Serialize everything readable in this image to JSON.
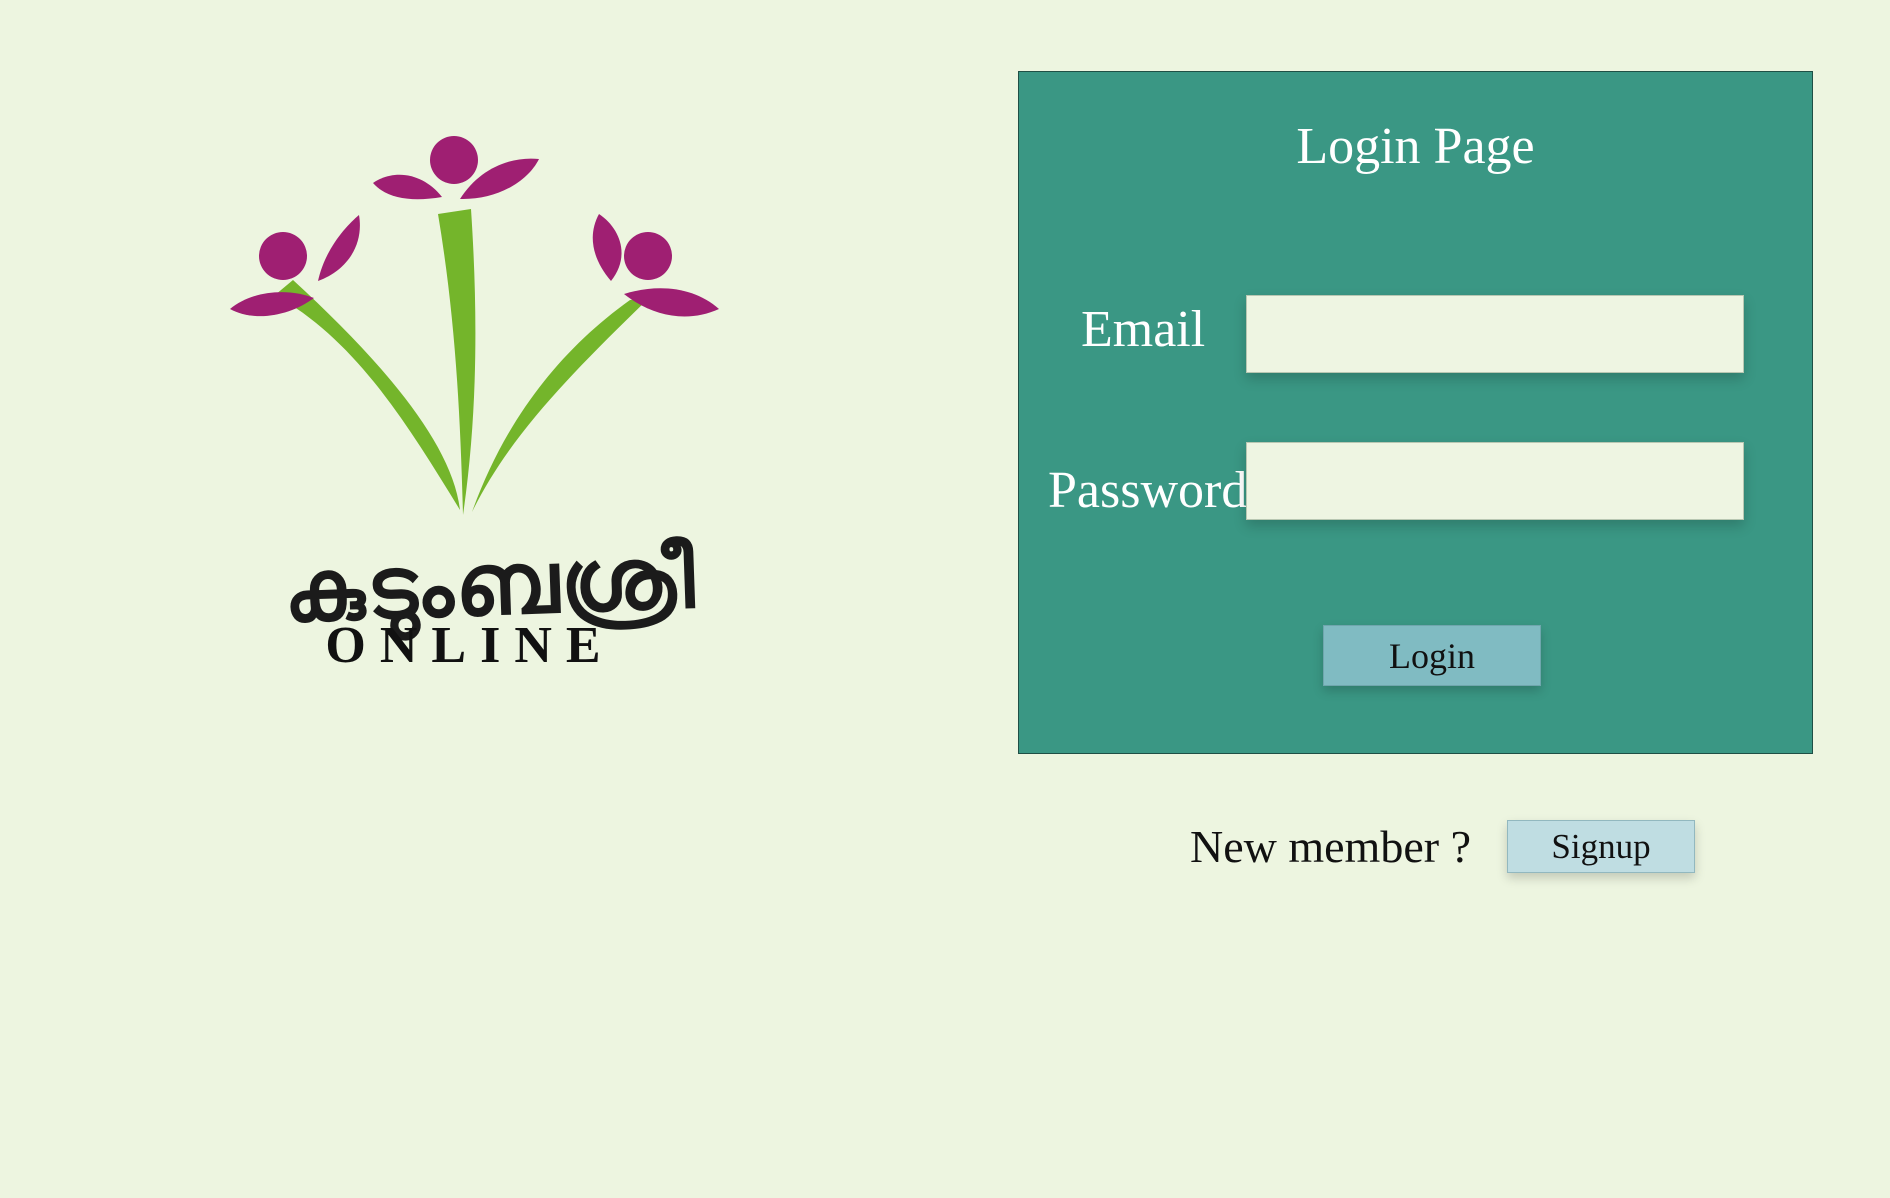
{
  "logo": {
    "script_text": "കുടുംബശ്രീ",
    "subtitle": "ONLINE",
    "colors": {
      "petal": "#9f1f72",
      "stem": "#74b52b",
      "text": "#1b1b1b"
    }
  },
  "login_panel": {
    "title": "Login Page",
    "email_label": "Email",
    "password_label": "Password",
    "login_button_label": "Login",
    "colors": {
      "panel_bg": "#3a9784",
      "button_bg": "#80bbc2",
      "input_bg": "#eef5e2"
    }
  },
  "signup": {
    "prompt": "New member ?",
    "button_label": "Signup",
    "colors": {
      "button_bg": "#bfdde2"
    }
  },
  "page": {
    "background": "#edf5e0"
  }
}
